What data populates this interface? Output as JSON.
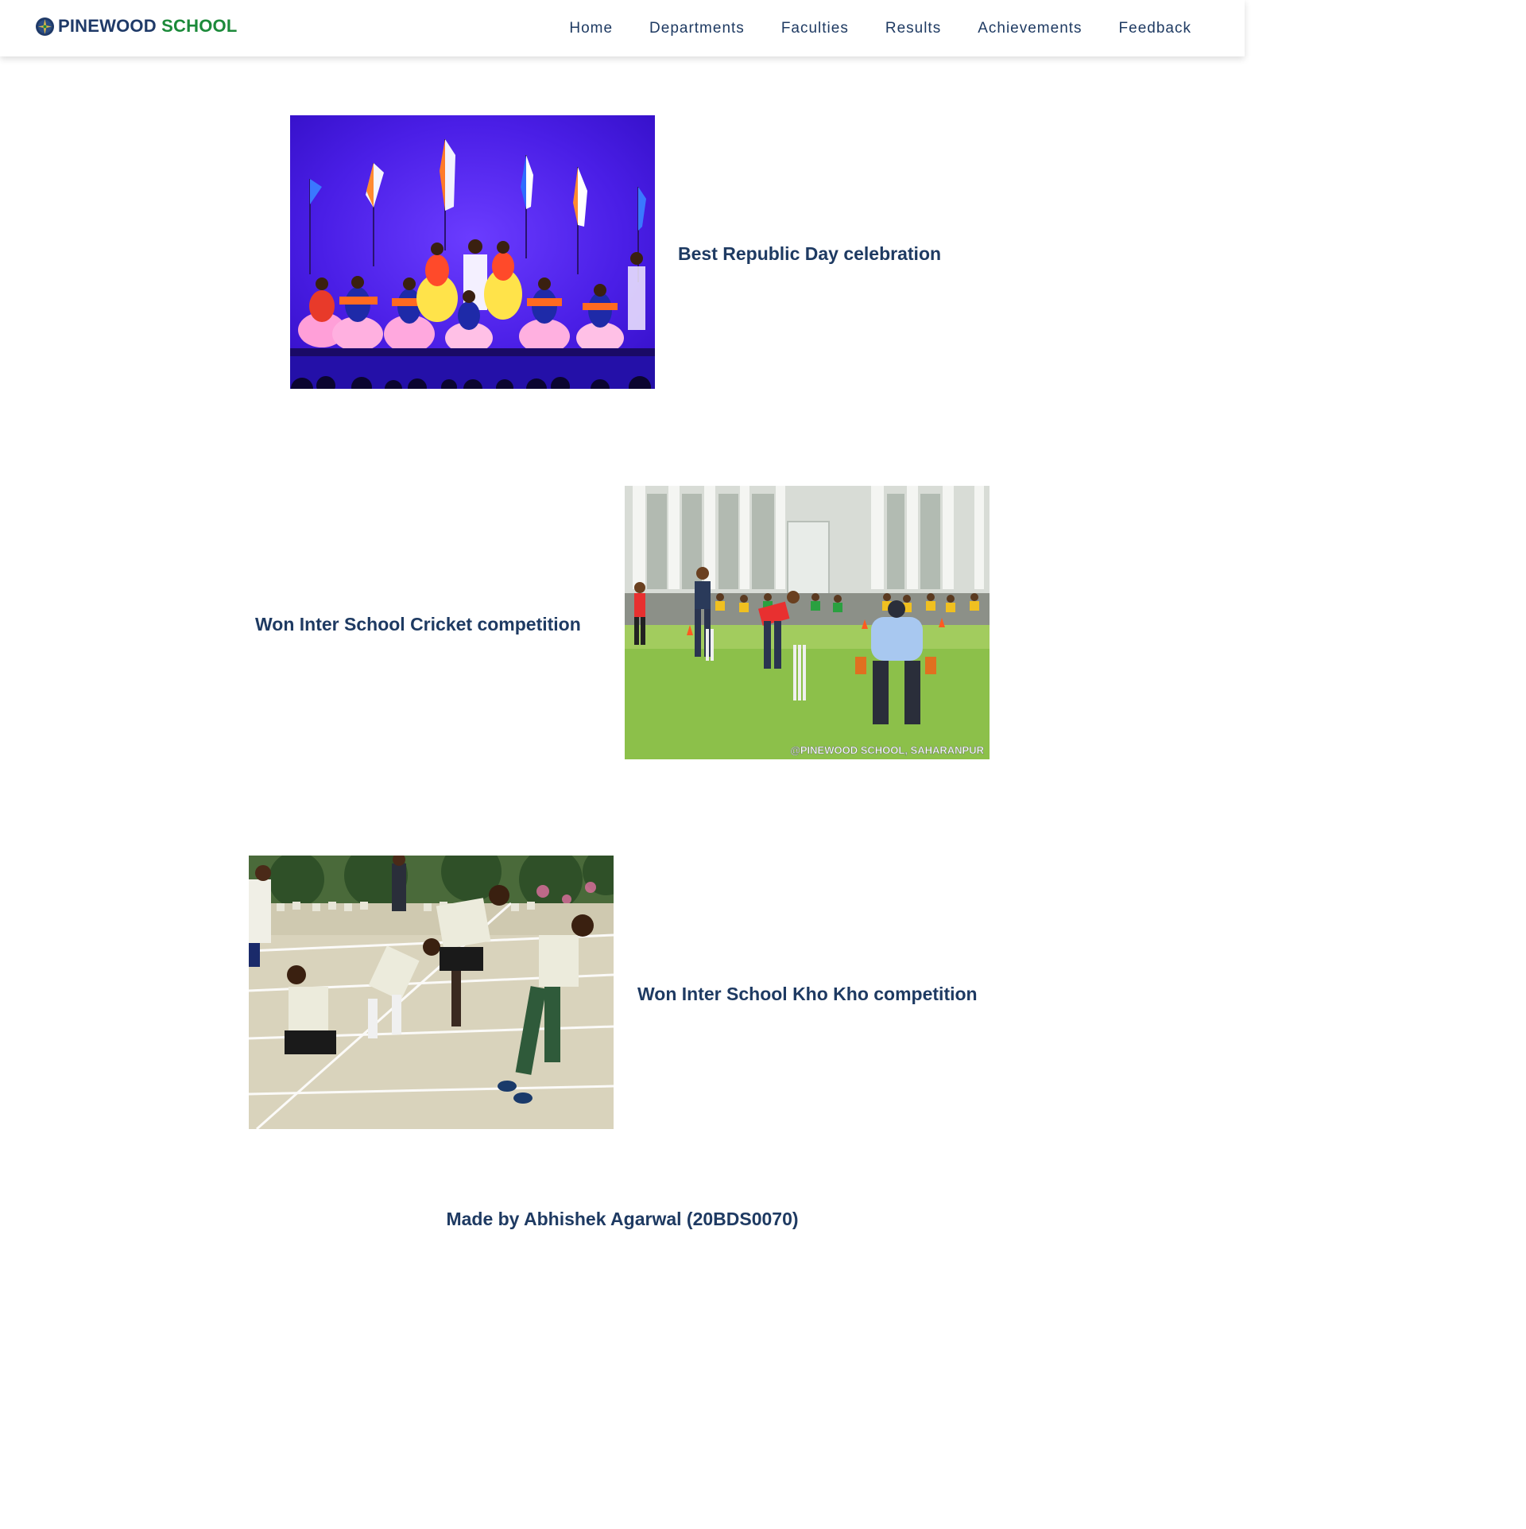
{
  "brand": {
    "name_part1": "PINEWOOD",
    "name_part2": "SCHOOL",
    "logo_icon": "school-crest-icon"
  },
  "nav": {
    "items": [
      {
        "label": "Home"
      },
      {
        "label": "Departments"
      },
      {
        "label": "Faculties"
      },
      {
        "label": "Results"
      },
      {
        "label": "Achievements"
      },
      {
        "label": "Feedback"
      }
    ]
  },
  "achievements": [
    {
      "caption": "Best Republic Day celebration",
      "photo_alt": "Students performing a Republic Day dance on stage with flags"
    },
    {
      "caption": "Won Inter School Cricket competition",
      "photo_alt": "Students playing cricket on the school ground",
      "watermark": "@PINEWOOD SCHOOL, SAHARANPUR"
    },
    {
      "caption": "Won Inter School Kho Kho competition",
      "photo_alt": "Students playing kho kho on the field"
    }
  ],
  "footer": {
    "text": "Made by Abhishek Agarwal (20BDS0070)"
  },
  "colors": {
    "primary_navy": "#1e3a62",
    "brand_green": "#1c8a3a",
    "stage_purple": "#4a1ee6",
    "grass_green": "#8cc04a"
  }
}
